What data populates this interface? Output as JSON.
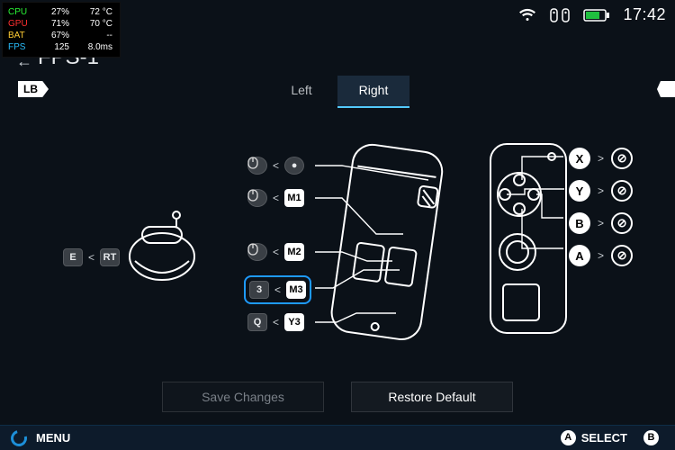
{
  "overlay": {
    "cpu": {
      "label": "CPU",
      "pct": "27%",
      "temp": "72 °C"
    },
    "gpu": {
      "label": "GPU",
      "pct": "71%",
      "temp": "70 °C"
    },
    "bat": {
      "label": "BAT",
      "pct": "67%",
      "temp": "--"
    },
    "fps": {
      "label": "FPS",
      "pct": "125",
      "temp": "8.0ms"
    }
  },
  "statusbar": {
    "time": "17:42"
  },
  "header": {
    "back": "←",
    "title": "FPS-1",
    "lb": "LB",
    "rb": ""
  },
  "tabs": {
    "left": "Left",
    "right": "Right",
    "active": "right"
  },
  "top_mapping": {
    "key": "E",
    "arrow": "<",
    "btn": "RT"
  },
  "center_maps": [
    {
      "icon": "mouse",
      "arrow": "<",
      "btn": "●",
      "btn_style": "circle dark"
    },
    {
      "icon": "mouse",
      "arrow": "<",
      "btn": "M1",
      "btn_style": "light"
    },
    {
      "icon": "mouse",
      "arrow": "<",
      "btn": "M2",
      "btn_style": "light"
    },
    {
      "key": "3",
      "arrow": "<",
      "btn": "M3",
      "btn_style": "light",
      "selected": true
    },
    {
      "key": "Q",
      "arrow": "<",
      "btn": "Y3",
      "btn_style": "light"
    }
  ],
  "face_maps": [
    {
      "btn": "X",
      "arrow": ">",
      "to": "⊘"
    },
    {
      "btn": "Y",
      "arrow": ">",
      "to": "⊘"
    },
    {
      "btn": "B",
      "arrow": ">",
      "to": "⊘"
    },
    {
      "btn": "A",
      "arrow": ">",
      "to": "⊘"
    }
  ],
  "actions": {
    "save": {
      "label": "Save Changes",
      "enabled": false
    },
    "restore": {
      "label": "Restore Default",
      "enabled": true
    }
  },
  "footer": {
    "menu": "MENU",
    "hints": [
      {
        "key": "A",
        "label": "SELECT"
      },
      {
        "key": "B",
        "label": ""
      }
    ]
  }
}
